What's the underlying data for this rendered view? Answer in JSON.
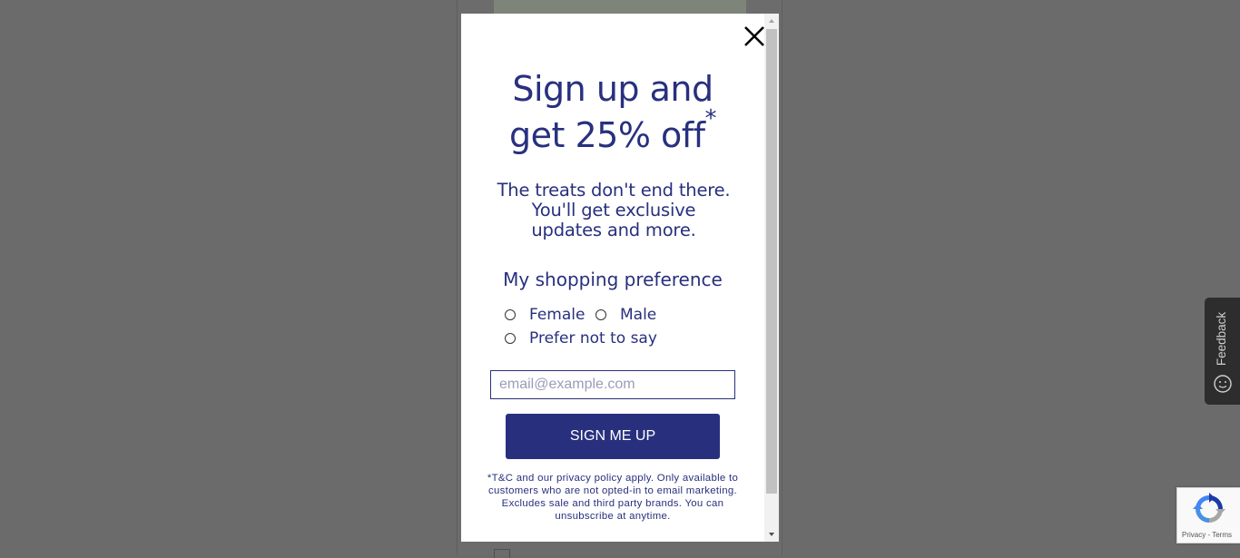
{
  "modal": {
    "title_line1": "Sign up and",
    "title_line2": "get 25% off",
    "title_asterisk": "*",
    "subtitle_lines": [
      "The treats don't end there.",
      "You'll get exclusive",
      "updates and more."
    ],
    "preference_heading": "My shopping preference",
    "options": [
      {
        "label": "Female",
        "selected": false
      },
      {
        "label": "Male",
        "selected": false
      },
      {
        "label": "Prefer not to say",
        "selected": false
      }
    ],
    "email_placeholder": "email@example.com",
    "email_value": "",
    "button_label": "SIGN ME UP",
    "fine_print": "*T&C and our privacy policy apply. Only available to customers who are not opted-in to email marketing. Excludes sale and third party brands. You can unsubscribe at anytime."
  },
  "feedback": {
    "label": "Feedback"
  },
  "recaptcha": {
    "privacy": "Privacy",
    "separator": " - ",
    "terms": "Terms"
  },
  "colors": {
    "brand": "#28307e",
    "overlay": "#6b6b6b",
    "feedback_bg": "#2d2d2d"
  },
  "icons": [
    "close-icon",
    "scroll-up-arrow-icon",
    "scroll-down-arrow-icon",
    "smiley-icon",
    "recaptcha-logo-icon"
  ]
}
